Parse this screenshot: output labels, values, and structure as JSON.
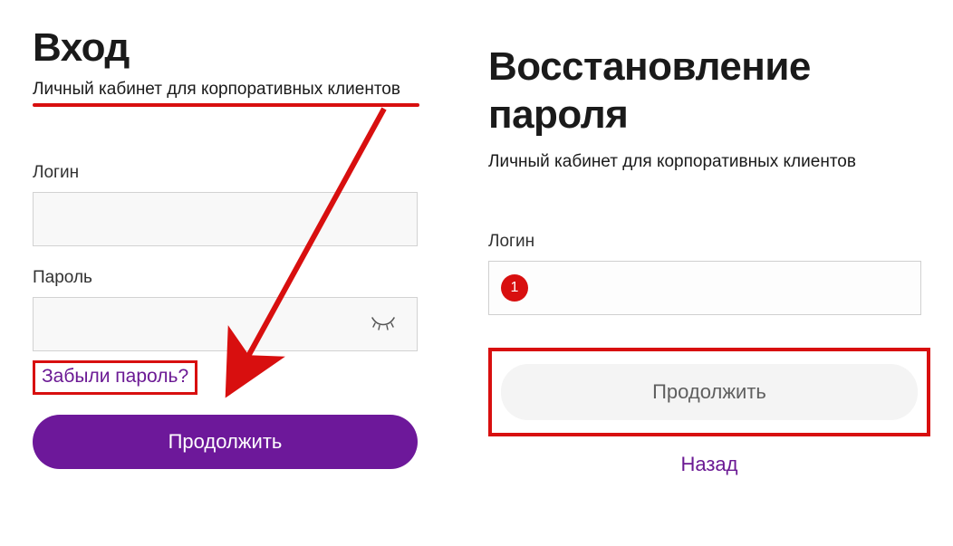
{
  "left": {
    "title": "Вход",
    "subtitle": "Личный кабинет для корпоративных клиентов",
    "login_label": "Логин",
    "login_value": "",
    "password_label": "Пароль",
    "password_value": "",
    "forgot_link": "Забыли пароль?",
    "continue_button": "Продолжить"
  },
  "right": {
    "title": "Восстановление пароля",
    "subtitle": "Личный кабинет для корпоративных клиентов",
    "login_label": "Логин",
    "login_value": "",
    "continue_button": "Продолжить",
    "back_link": "Назад"
  },
  "annotations": {
    "marker_1": "1",
    "highlight_color": "#d80f0f",
    "accent_color": "#6d189a"
  }
}
